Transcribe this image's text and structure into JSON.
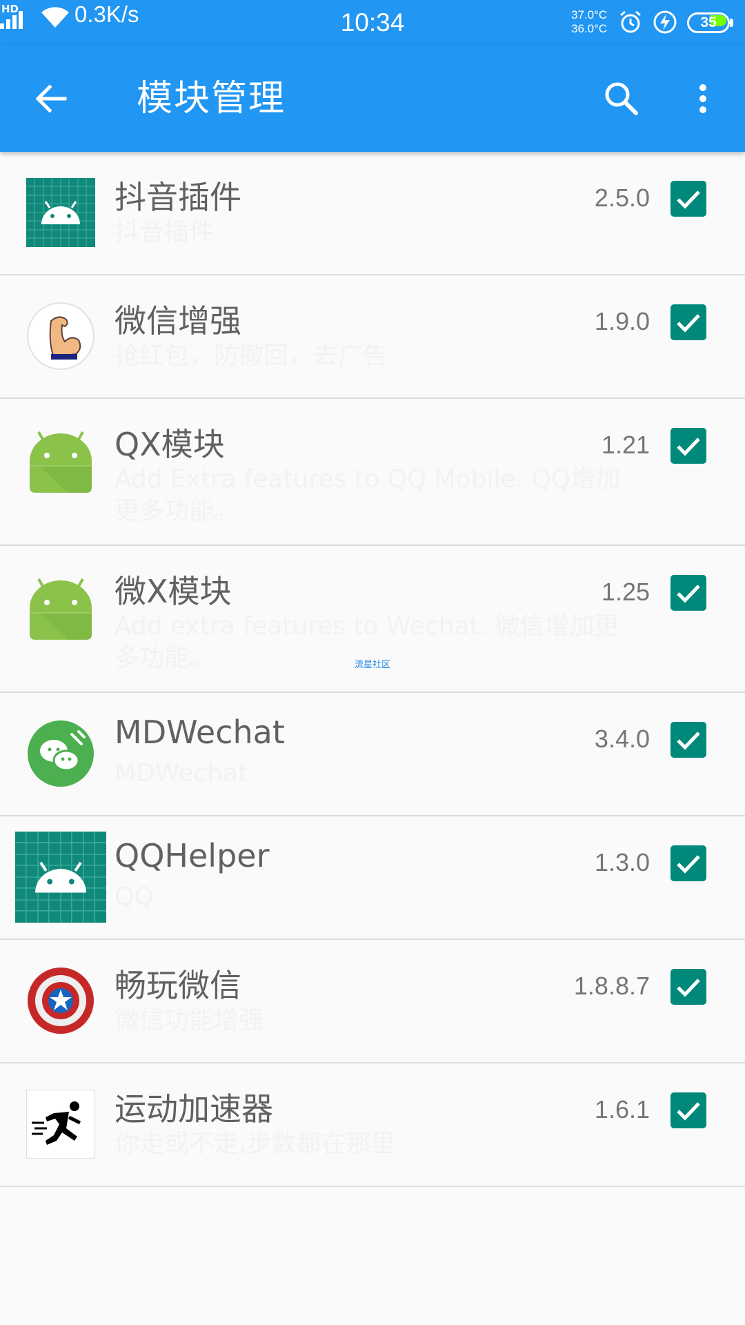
{
  "status_bar": {
    "hd": "HD",
    "net_speed": "0.3K/s",
    "time": "10:34",
    "temp1": "37.0°C",
    "temp2": "36.0°C",
    "battery": "35",
    "icons": [
      "signal-icon",
      "wifi-icon",
      "alarm-icon",
      "charging-icon",
      "battery-icon"
    ]
  },
  "toolbar": {
    "title": "模块管理",
    "back_icon": "arrow-back-icon",
    "search_icon": "search-icon",
    "more_icon": "more-vert-icon"
  },
  "colors": {
    "primary": "#2196f3",
    "checkbox": "#00897b",
    "background": "#fafafa"
  },
  "modules": [
    {
      "name": "抖音插件",
      "description": "抖音插件",
      "version": "2.5.0",
      "enabled": true,
      "icon": "android-grid-icon"
    },
    {
      "name": "微信增强",
      "description": "抢红包，防撤回，去广告",
      "version": "1.9.0",
      "enabled": true,
      "icon": "muscle-arm-icon"
    },
    {
      "name": "QX模块",
      "description": "Add Extra features to QQ Mobile. QQ增加更多功能。",
      "version": "1.21",
      "enabled": true,
      "icon": "android-robot-icon"
    },
    {
      "name": "微X模块",
      "description": "Add extra features to Wechat. 微信增加更多功能。",
      "version": "1.25",
      "enabled": true,
      "icon": "android-robot-icon"
    },
    {
      "name": "MDWechat",
      "description": "MDWechat",
      "version": "3.4.0",
      "enabled": true,
      "icon": "wechat-tool-icon"
    },
    {
      "name": "QQHelper",
      "description": "QQ",
      "version": "1.3.0",
      "enabled": true,
      "icon": "android-grid-icon"
    },
    {
      "name": "畅玩微信",
      "description": "微信功能增强",
      "version": "1.8.8.7",
      "enabled": true,
      "icon": "captain-shield-icon"
    },
    {
      "name": "运动加速器",
      "description": "你走或不走,步数都在那里",
      "version": "1.6.1",
      "enabled": true,
      "icon": "running-man-icon"
    }
  ],
  "watermark": "流星社区"
}
